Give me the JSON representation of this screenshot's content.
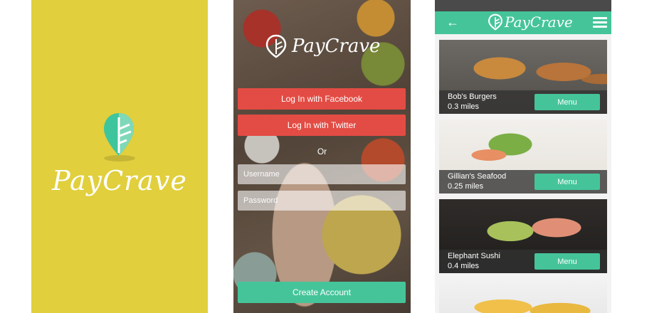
{
  "brand": {
    "name": "PayCrave"
  },
  "colors": {
    "splash_bg": "#e1cf3d",
    "accent": "#45c49a",
    "social_red": "#e34c44",
    "status_bar": "#4a4a4a"
  },
  "login": {
    "facebook_label": "Log In with Facebook",
    "twitter_label": "Log In with Twitter",
    "or_label": "Or",
    "username_placeholder": "Username",
    "password_placeholder": "Password",
    "create_account_label": "Create Account"
  },
  "list": {
    "back_icon": "arrow-left-icon",
    "menu_icon": "hamburger-menu-icon",
    "restaurants": [
      {
        "name": "Bob's Burgers",
        "distance": "0.3 miles",
        "button": "Menu"
      },
      {
        "name": "Gillian's Seafood",
        "distance": "0.25 miles",
        "button": "Menu"
      },
      {
        "name": "Elephant Sushi",
        "distance": "0.4 miles",
        "button": "Menu"
      }
    ]
  }
}
